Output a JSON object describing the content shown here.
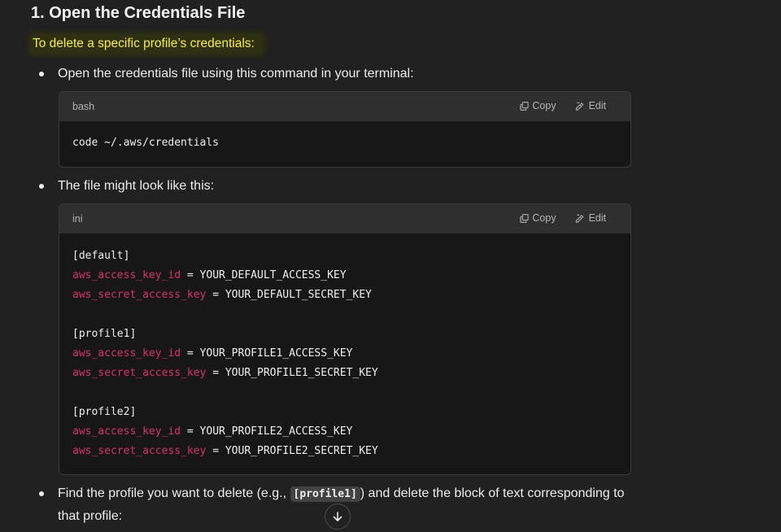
{
  "heading": "1. Open the Credentials File",
  "highlight_text": "To delete a specific profile’s credentials:",
  "bullets": [
    {
      "text": "Open the credentials file using this command in your terminal:"
    },
    {
      "text": "The file might look like this:"
    },
    {
      "text_before": "Find the profile you want to delete (e.g., ",
      "code": "[profile1]",
      "text_after": ") and delete the block of text corresponding to that profile:"
    }
  ],
  "code_blocks": [
    {
      "lang": "bash",
      "copy_label": "Copy",
      "edit_label": "Edit",
      "lines": [
        "code ~/.aws/credentials"
      ]
    },
    {
      "lang": "ini",
      "copy_label": "Copy",
      "edit_label": "Edit",
      "lines": [
        {
          "section": "[default]"
        },
        {
          "key": "aws_access_key_id",
          "sep": " = ",
          "value": "YOUR_DEFAULT_ACCESS_KEY"
        },
        {
          "key": "aws_secret_access_key",
          "sep": " = ",
          "value": "YOUR_DEFAULT_SECRET_KEY"
        },
        {
          "blank": ""
        },
        {
          "section": "[profile1]"
        },
        {
          "key": "aws_access_key_id",
          "sep": " = ",
          "value": "YOUR_PROFILE1_ACCESS_KEY"
        },
        {
          "key": "aws_secret_access_key",
          "sep": " = ",
          "value": "YOUR_PROFILE1_SECRET_KEY"
        },
        {
          "blank": ""
        },
        {
          "section": "[profile2]"
        },
        {
          "key": "aws_access_key_id",
          "sep": " = ",
          "value": "YOUR_PROFILE2_ACCESS_KEY"
        },
        {
          "key": "aws_secret_access_key",
          "sep": " = ",
          "value": "YOUR_PROFILE2_SECRET_KEY"
        }
      ]
    }
  ],
  "colors": {
    "background": "#212121",
    "highlight_text": "#f5ef3a",
    "ini_key": "#d6336c"
  },
  "icons": {
    "copy": "copy-icon",
    "edit": "edit-icon",
    "scroll": "arrow-down-icon"
  }
}
